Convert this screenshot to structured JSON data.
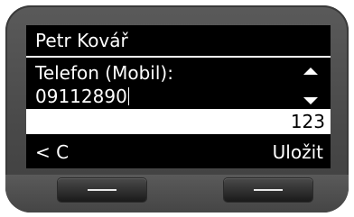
{
  "contact": {
    "name": "Petr Kovář"
  },
  "field": {
    "label": "Telefon (Mobil):",
    "value": "09112890"
  },
  "input_mode": "123",
  "softkeys": {
    "left_label": "< C",
    "right_label": "Uložit"
  },
  "icons": {
    "scroll_up": "triangle-up",
    "scroll_down": "triangle-down",
    "softkey_button_glyph": "horizontal-bar"
  },
  "colors": {
    "screen_background": "#000000",
    "screen_text": "#ffffff",
    "device_body": "#4a4a4a"
  }
}
